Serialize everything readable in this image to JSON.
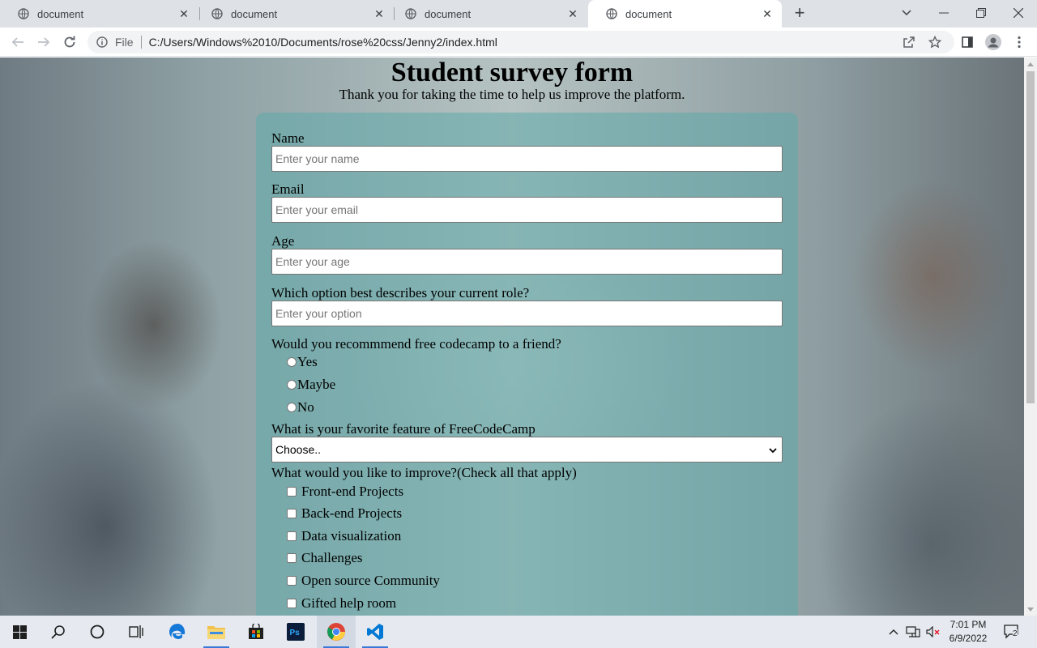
{
  "browser": {
    "tabs": [
      {
        "title": "document",
        "active": false
      },
      {
        "title": "document",
        "active": false
      },
      {
        "title": "document",
        "active": false
      },
      {
        "title": "document",
        "active": true
      }
    ],
    "omnibox": {
      "scheme_label": "File",
      "url": "C:/Users/Windows%2010/Documents/rose%20css/Jenny2/index.html"
    }
  },
  "page": {
    "title": "Student survey form",
    "subtitle": "Thank you for taking the time to help us improve the platform.",
    "form": {
      "name": {
        "label": "Name",
        "placeholder": "Enter your name"
      },
      "email": {
        "label": "Email",
        "placeholder": "Enter your email"
      },
      "age": {
        "label": "Age",
        "placeholder": "Enter your age"
      },
      "role": {
        "label": "Which option best describes your current role?",
        "placeholder": "Enter your option"
      },
      "recommend": {
        "question": "Would you recommmend free codecamp to a friend?",
        "options": [
          "Yes",
          "Maybe",
          "No"
        ]
      },
      "feature": {
        "label": "What is your favorite feature of FreeCodeCamp",
        "selected": "Choose.."
      },
      "improve": {
        "label": "What would you like to improve?(Check all that apply)",
        "options": [
          "Front-end Projects",
          "Back-end Projects",
          "Data visualization",
          "Challenges",
          "Open source Community",
          "Gifted help room"
        ]
      }
    }
  },
  "taskbar": {
    "time": "7:01 PM",
    "date": "6/9/2022",
    "notification_count": "2"
  },
  "colors": {
    "panel": "#5faaaa",
    "chrome_tabstrip": "#dee1e6",
    "taskbar": "#e6eaf0"
  }
}
